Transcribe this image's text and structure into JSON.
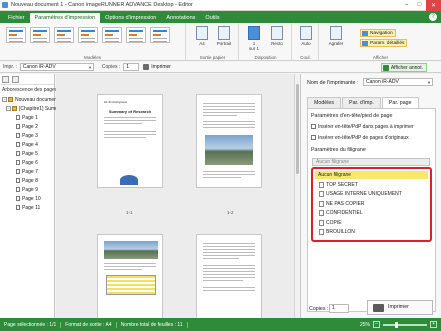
{
  "window": {
    "title": "Nouveau document 1 - Canon imageRUNNER ADVANCE Desktop - Editor",
    "minimize": "–",
    "maximize": "□",
    "close": "✕"
  },
  "menu": {
    "tabs": [
      "Fichier",
      "Paramètres d'impression",
      "Options d'impression",
      "Annotations",
      "Outils"
    ],
    "help": "?"
  },
  "ribbon": {
    "groups": {
      "modeles": "Modèles",
      "sortie": "Sortie papier",
      "disposition": "Disposition",
      "coul": "Coul.",
      "afficher": "Afficher"
    },
    "buttons": {
      "size": "A4",
      "orientation": "Portrait",
      "pages_per_sheet": "1",
      "pages_per_sheet_sub": "sur 1",
      "duplex": "Recto",
      "color": "Auto",
      "staple": "Agrafer",
      "navigation": "Navigation",
      "detailed": "Param. détaillés"
    }
  },
  "toolbar": {
    "printer_label": "Impr. :",
    "printer_value": "Canon iR-ADV",
    "copies_label": "Copies :",
    "copies_value": "1",
    "print_button": "Imprimer",
    "annot_button": "Afficher annot."
  },
  "left": {
    "header": "Arborescence des pages",
    "tree": [
      {
        "label": "Nouveau document 1",
        "type": "root"
      },
      {
        "label": "[Chapitre1] Summary o",
        "type": "chapter"
      },
      {
        "label": "Page 1",
        "type": "page"
      },
      {
        "label": "Page 2",
        "type": "page"
      },
      {
        "label": "Page 3",
        "type": "page"
      },
      {
        "label": "Page 4",
        "type": "page"
      },
      {
        "label": "Page 5",
        "type": "page"
      },
      {
        "label": "Page 6",
        "type": "page"
      },
      {
        "label": "Page 7",
        "type": "page"
      },
      {
        "label": "Page 8",
        "type": "page"
      },
      {
        "label": "Page 9",
        "type": "page"
      },
      {
        "label": "Page 10",
        "type": "page"
      },
      {
        "label": "Page 11",
        "type": "page"
      }
    ]
  },
  "canvas": {
    "page1_header": "ILL-01 Anonymous",
    "page1_title": "Summary of Research",
    "page_labels": [
      "1-1",
      "1-2"
    ]
  },
  "right": {
    "printer_label": "Nom de l'imprimante :",
    "printer_value": "Canon iR-ADV",
    "tabs": [
      "Modèles",
      "Par. d'imp.",
      "Par. page"
    ],
    "section1": "Paramètres d'en-tête/pied de page",
    "check1": "Insérer en-tête/PdP dans pages à imprimer",
    "check2": "Insérer en-tête/PdP de pages d'originaux",
    "section2": "Paramètres du filigrane",
    "watermark_combo": "Aucun filigrane",
    "watermarks": [
      "Aucun filigrane",
      "TOP SECRET",
      "USAGE INTERNE UNIQUEMENT",
      "NE PAS COPIER",
      "CONFIDENTIEL",
      "COPIE",
      "BROUILLON"
    ],
    "copies_label": "Copies :",
    "copies_value": "1",
    "print_button": "Imprimer"
  },
  "status": {
    "selected": "Page sélectionnée : 1/1",
    "format": "Format de sortie : A4",
    "sheets": "Nombre total de feuilles : 11",
    "zoom": "25%",
    "zoom_minus": "–",
    "zoom_plus": "+"
  },
  "colors": {
    "accent": "#2e8b3a",
    "highlight": "#dc1f2a",
    "selection": "#fbe86a"
  }
}
